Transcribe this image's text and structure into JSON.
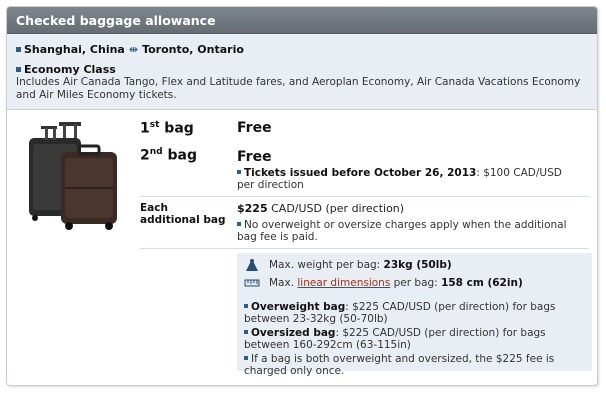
{
  "header": {
    "title": "Checked baggage allowance"
  },
  "route": {
    "origin": "Shanghai, China",
    "destination": "Toronto, Ontario",
    "class_name": "Economy Class",
    "class_description": "Includes Air Canada Tango, Flex and Latitude fares, and Aeroplan Economy, Air Canada Vacations Economy and Air Miles Economy tickets."
  },
  "bags": {
    "first": {
      "num": "1",
      "ordinal": "st",
      "word": "bag",
      "value": "Free"
    },
    "second": {
      "num": "2",
      "ordinal": "nd",
      "word": "bag",
      "value": "Free",
      "note_bold": "Tickets issued before October 26, 2013",
      "note_rest": ": $100 CAD/USD per direction"
    },
    "additional": {
      "label": "Each additional bag",
      "price": "$225",
      "price_rest": " CAD/USD (per direction)",
      "note": "No overweight or oversize charges apply when the additional bag fee is paid."
    }
  },
  "limits": {
    "weight_label": "Max. weight per bag: ",
    "weight_value": "23kg (50lb)",
    "dim_prefix": "Max. ",
    "dim_link": "linear dimensions",
    "dim_label": " per bag: ",
    "dim_value": "158 cm (62in)",
    "overweight_bold": "Overweight bag",
    "overweight_rest": ": $225 CAD/USD (per direction) for bags between 23-32kg (50-70lb)",
    "oversized_bold": "Oversized bag",
    "oversized_rest": ": $225 CAD/USD (per direction) for bags between 160-292cm (63-115in)",
    "both_note": "If a bag is both overweight and oversized, the $225 fee is charged only once."
  },
  "icons": [
    "bullet-icon",
    "arrows-icon",
    "suitcase-icon",
    "weight-icon",
    "ruler-icon"
  ],
  "colors": {
    "header": "#6f767d",
    "panel_bg": "#e8eef3",
    "link": "#a3321e",
    "bullet": "#2b5c8a"
  }
}
